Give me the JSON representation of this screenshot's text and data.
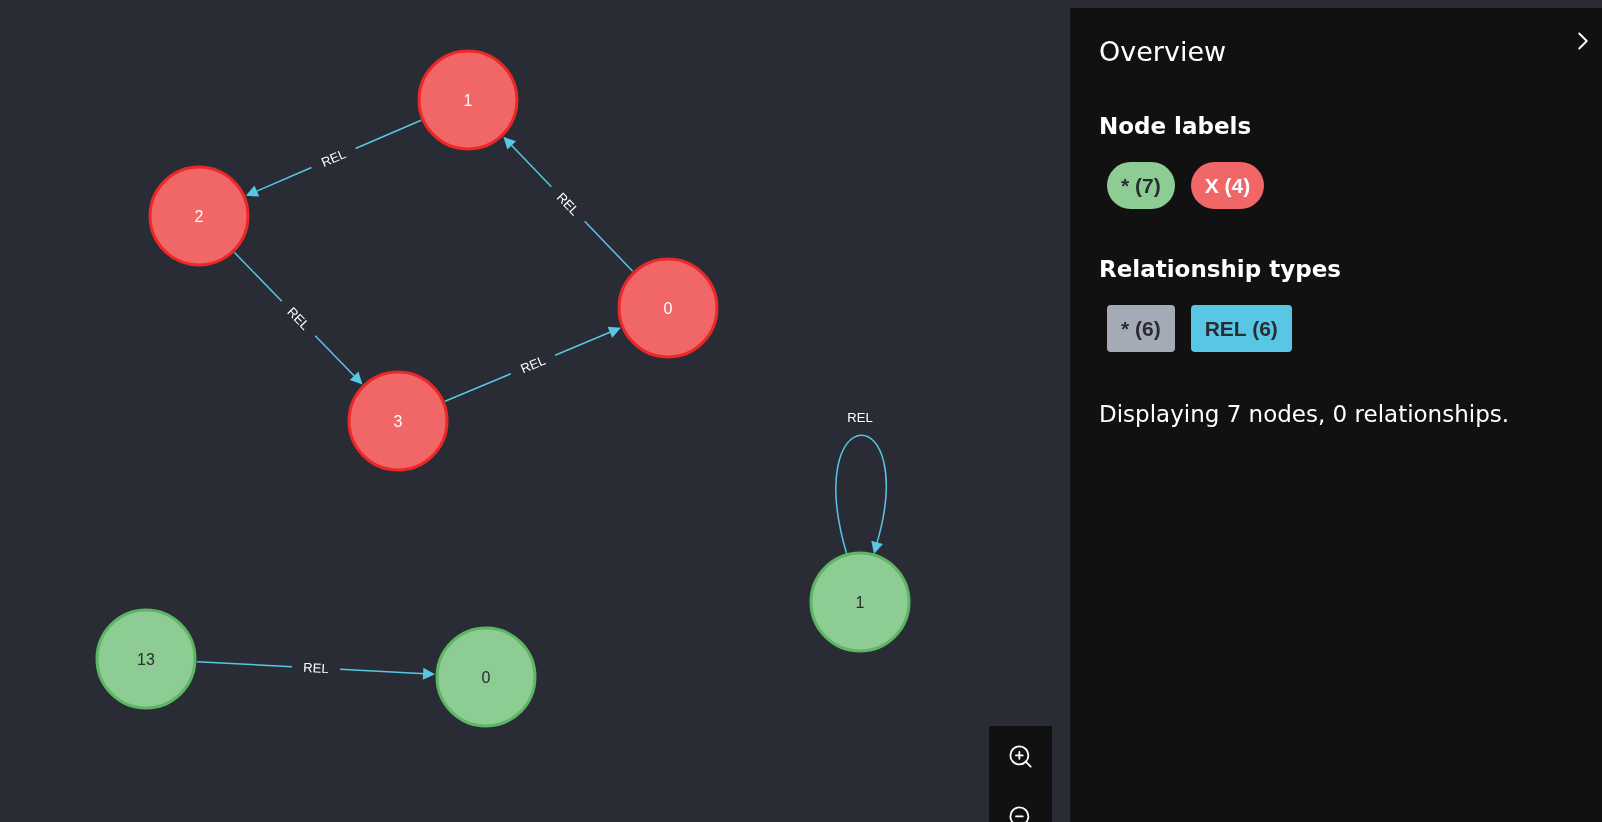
{
  "graph": {
    "nodes": [
      {
        "caption": "1",
        "color": "#f16667"
      },
      {
        "caption": "2",
        "color": "#f16667"
      },
      {
        "caption": "0",
        "color": "#f16667"
      },
      {
        "caption": "3",
        "color": "#f16667"
      },
      {
        "caption": "1",
        "color": "#8dcc93"
      },
      {
        "caption": "13",
        "color": "#8dcc93"
      },
      {
        "caption": "0",
        "color": "#8dcc93"
      }
    ],
    "relationships": [
      {
        "type": "REL"
      },
      {
        "type": "REL"
      },
      {
        "type": "REL"
      },
      {
        "type": "REL"
      },
      {
        "type": "REL"
      },
      {
        "type": "REL"
      }
    ]
  },
  "overview": {
    "title": "Overview",
    "node_labels": {
      "heading": "Node labels",
      "items": [
        {
          "text": "* (7)",
          "color": "#8dcc93"
        },
        {
          "text": "X (4)",
          "color": "#f16667"
        }
      ]
    },
    "relationship_types": {
      "heading": "Relationship types",
      "items": [
        {
          "text": "* (6)",
          "color": "#a5abb6"
        },
        {
          "text": "REL (6)",
          "color": "#57c7e3"
        }
      ]
    },
    "summary": "Displaying 7 nodes, 0 relationships."
  }
}
